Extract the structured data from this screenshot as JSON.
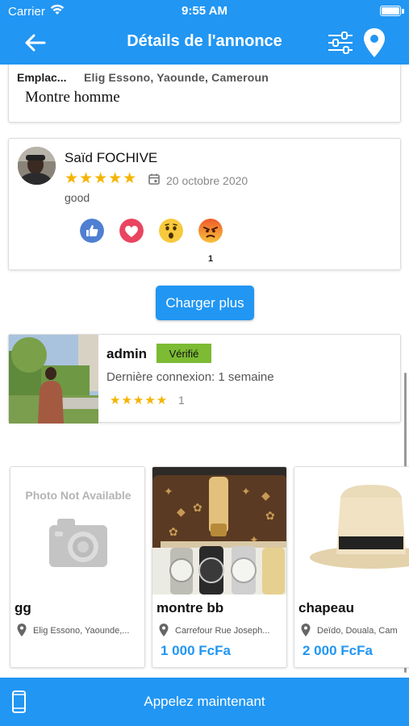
{
  "status_bar": {
    "carrier": "Carrier",
    "time": "9:55 AM"
  },
  "nav": {
    "title": "Détails de l'annonce",
    "icons": [
      "back-arrow-icon",
      "filter-sliders-icon",
      "location-pin-icon"
    ]
  },
  "listing": {
    "location_label": "Emplac...",
    "location_value": "Elig Essono, Yaounde, Cameroun",
    "description": "Montre homme"
  },
  "review": {
    "reviewer": "Saïd FOCHIVE",
    "stars": "★★★★★",
    "date": "20 octobre 2020",
    "comment": "good",
    "reactions": [
      "like",
      "love",
      "wow",
      "angry"
    ],
    "reaction_count": "1"
  },
  "load_more_label": "Charger plus",
  "seller": {
    "name": "admin",
    "badge": "Vérifié",
    "last_seen": "Dernière connexion: 1 semaine",
    "stars": "★★★★★",
    "rating_count": "1"
  },
  "products": [
    {
      "title": "gg",
      "location": "Elig Essono, Yaounde,...",
      "price": "",
      "image": "photo-not-available",
      "placeholder_text": "Photo Not Available"
    },
    {
      "title": "montre bb",
      "location": "Carrefour Rue Joseph...",
      "price": "1 000 FcFa",
      "image": "watches-in-case"
    },
    {
      "title": "chapeau",
      "location": "Deïdo, Douala, Cam",
      "price": "2 000 FcFa",
      "image": "hat"
    }
  ],
  "footer": {
    "call_label": "Appelez maintenant"
  },
  "colors": {
    "primary": "#2196f3",
    "star": "#f5b400",
    "verified": "#7cbb33"
  }
}
